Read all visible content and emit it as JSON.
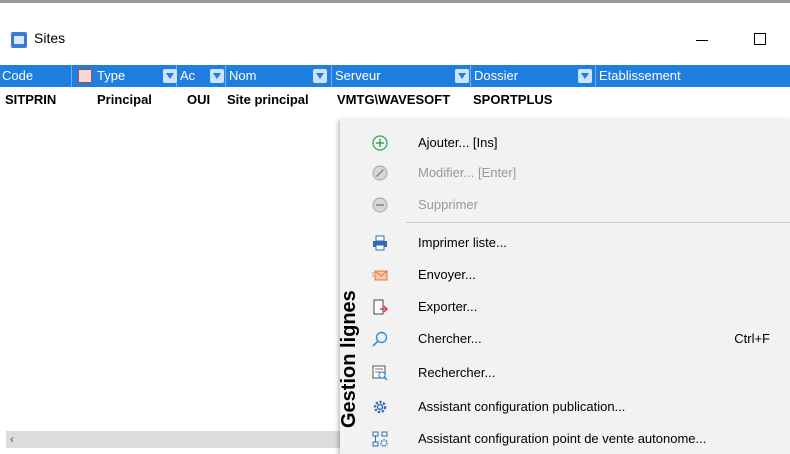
{
  "window": {
    "title": "Sites",
    "minimize_label": "—",
    "maximize_label": "☐"
  },
  "grid": {
    "columns": [
      "Code",
      "Type",
      "Ac",
      "Nom",
      "Serveur",
      "Dossier",
      "Etablissement"
    ],
    "rows": [
      [
        "SITPRIN",
        "Principal",
        "OUI",
        "Site principal",
        "VMTG\\WAVESOFT",
        "SPORTPLUS",
        ""
      ]
    ]
  },
  "scrollbar": {
    "left_arrow": "‹"
  },
  "context_menu": {
    "group_label": "Gestion lignes",
    "items": [
      {
        "label": "Ajouter... [Ins]",
        "icon": "add-icon",
        "enabled": true
      },
      {
        "label": "Modifier... [Enter]",
        "icon": "edit-icon",
        "enabled": false
      },
      {
        "label": "Supprimer",
        "icon": "delete-icon",
        "enabled": false
      },
      {
        "label": "Imprimer liste...",
        "icon": "printer-icon",
        "enabled": true
      },
      {
        "label": "Envoyer...",
        "icon": "mail-icon",
        "enabled": true
      },
      {
        "label": "Exporter...",
        "icon": "export-icon",
        "enabled": true
      },
      {
        "label": "Chercher...",
        "shortcut": "Ctrl+F",
        "icon": "search-icon",
        "enabled": true
      },
      {
        "label": "Rechercher...",
        "icon": "advanced-search-icon",
        "enabled": true
      },
      {
        "label": "Assistant configuration publication...",
        "icon": "gear-icon",
        "enabled": true
      },
      {
        "label": "Assistant configuration point de vente autonome...",
        "icon": "network-gear-icon",
        "enabled": true
      }
    ]
  },
  "colors": {
    "header_bg": "#1e7fe0",
    "menu_bg": "#f2f2f2"
  }
}
